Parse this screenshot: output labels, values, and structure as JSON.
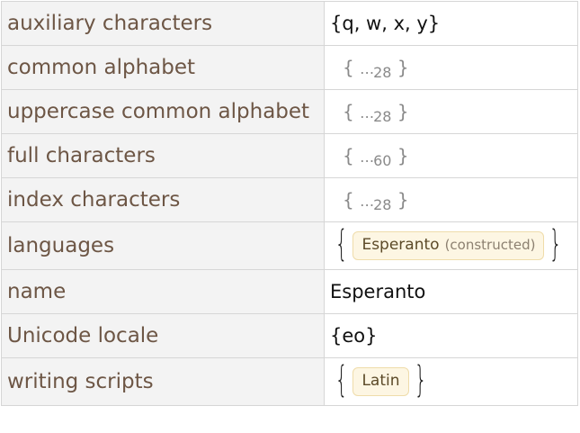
{
  "rows": [
    {
      "key": "auxiliary characters",
      "value": "{q, w, x, y}"
    },
    {
      "key": "common alphabet",
      "elided_count": "28"
    },
    {
      "key": "uppercase common alphabet",
      "elided_count": "28"
    },
    {
      "key": "full characters",
      "elided_count": "60"
    },
    {
      "key": "index characters",
      "elided_count": "28"
    },
    {
      "key": "languages",
      "chip_label": "Esperanto",
      "chip_sub": "(constructed)"
    },
    {
      "key": "name",
      "value": "Esperanto"
    },
    {
      "key": "Unicode locale",
      "value": "{eo}"
    },
    {
      "key": "writing scripts",
      "chip_label": "Latin"
    }
  ],
  "elided_open": "{",
  "elided_dots": "…",
  "elided_close": "}",
  "brace_open": "{",
  "brace_close": "}"
}
